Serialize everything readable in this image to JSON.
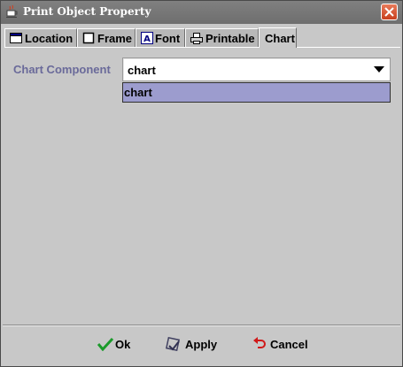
{
  "window": {
    "title": "Print Object Property",
    "icons": {
      "app": "java-cup-icon",
      "close": "close-icon"
    },
    "close_color": "#d8502e"
  },
  "tabs": [
    {
      "label": "Location",
      "icon": "window-icon",
      "active": false
    },
    {
      "label": "Frame",
      "icon": "frame-icon",
      "active": false
    },
    {
      "label": "Font",
      "icon": "font-icon",
      "active": false
    },
    {
      "label": "Printable",
      "icon": "printer-icon",
      "active": false
    },
    {
      "label": "Chart",
      "icon": null,
      "active": true
    }
  ],
  "chart_panel": {
    "component_label": "Chart Component",
    "component_value": "chart",
    "dropdown_options": [
      "chart"
    ],
    "highlight_color": "#9c9cce"
  },
  "buttons": {
    "ok": {
      "label": "Ok",
      "icon": "checkmark-icon"
    },
    "apply": {
      "label": "Apply",
      "icon": "apply-icon"
    },
    "cancel": {
      "label": "Cancel",
      "icon": "undo-arrow-icon"
    }
  }
}
